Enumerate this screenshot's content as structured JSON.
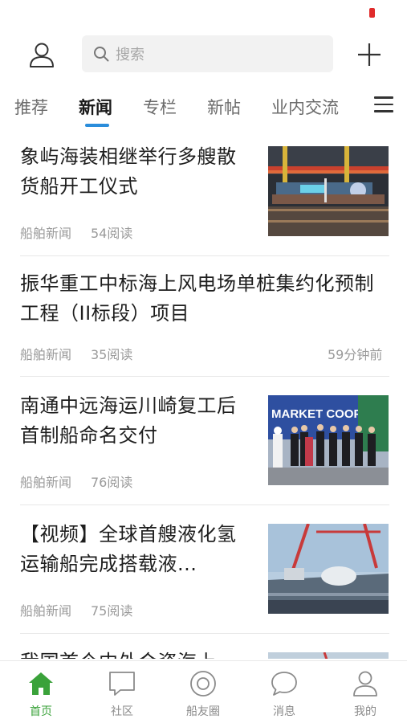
{
  "header": {
    "search_placeholder": "搜索",
    "icons": {
      "profile": "user-icon",
      "search": "search-icon",
      "add": "plus-icon"
    }
  },
  "tabs": [
    {
      "label": "推荐",
      "active": false
    },
    {
      "label": "新闻",
      "active": true
    },
    {
      "label": "专栏",
      "active": false
    },
    {
      "label": "新帖",
      "active": false
    },
    {
      "label": "业内交流",
      "active": false
    }
  ],
  "feed": [
    {
      "title": "象屿海装相继举行多艘散货船开工仪式",
      "source": "船舶新闻",
      "reads": "54阅读",
      "time": ""
    },
    {
      "title": "振华重工中标海上风电场单桩集约化预制工程（II标段）项目",
      "source": "船舶新闻",
      "reads": "35阅读",
      "time": "59分钟前"
    },
    {
      "title": "南通中远海运川崎复工后首制船命名交付",
      "source": "船舶新闻",
      "reads": "76阅读",
      "time": ""
    },
    {
      "title": "【视频】全球首艘液化氢运输船完成搭载液...",
      "source": "船舶新闻",
      "reads": "75阅读",
      "time": ""
    },
    {
      "title": "我国首个中外合资海上",
      "source": "",
      "reads": "",
      "time": ""
    }
  ],
  "images": {
    "banner_text": "MARKET COOPER"
  },
  "bottom_nav": [
    {
      "label": "首页",
      "icon": "home-icon",
      "active": true
    },
    {
      "label": "社区",
      "icon": "chat-square-icon",
      "active": false
    },
    {
      "label": "船友圈",
      "icon": "circle-target-icon",
      "active": false
    },
    {
      "label": "消息",
      "icon": "message-bubble-icon",
      "active": false
    },
    {
      "label": "我的",
      "icon": "user-icon",
      "active": false
    }
  ],
  "colors": {
    "accent_blue": "#2a8ddb",
    "active_green": "#3aa23a",
    "status_red": "#e02b2b"
  }
}
